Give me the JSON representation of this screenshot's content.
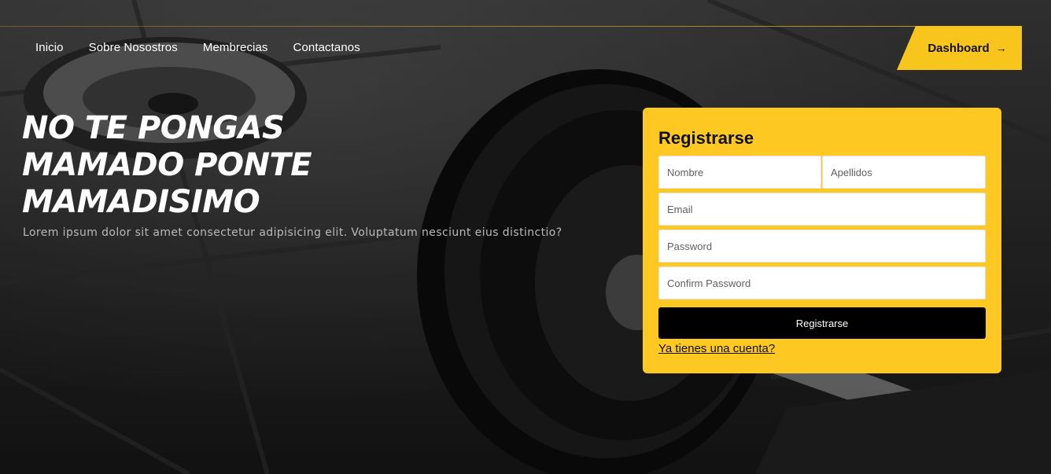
{
  "nav": {
    "items": [
      {
        "label": "Inicio"
      },
      {
        "label": "Sobre Nosostros"
      },
      {
        "label": "Membrecias"
      },
      {
        "label": "Contactanos"
      }
    ],
    "dashboard_label": "Dashboard",
    "dashboard_icon": "arrow-right-icon"
  },
  "hero": {
    "title": "NO TE PONGAS MAMADO PONTE MAMADISIMO",
    "text": "Lorem ipsum dolor sit amet consectetur adipisicing elit. Voluptatum nesciunt eius distinctio?"
  },
  "register": {
    "title": "Registrarse",
    "first_name_placeholder": "Nombre",
    "last_name_placeholder": "Apellidos",
    "email_placeholder": "Email",
    "password_placeholder": "Password",
    "confirm_password_placeholder": "Confirm Password",
    "submit_label": "Registrarse",
    "login_link": "Ya tienes una cuenta?"
  },
  "colors": {
    "accent": "#fcc821",
    "button": "#000000"
  }
}
